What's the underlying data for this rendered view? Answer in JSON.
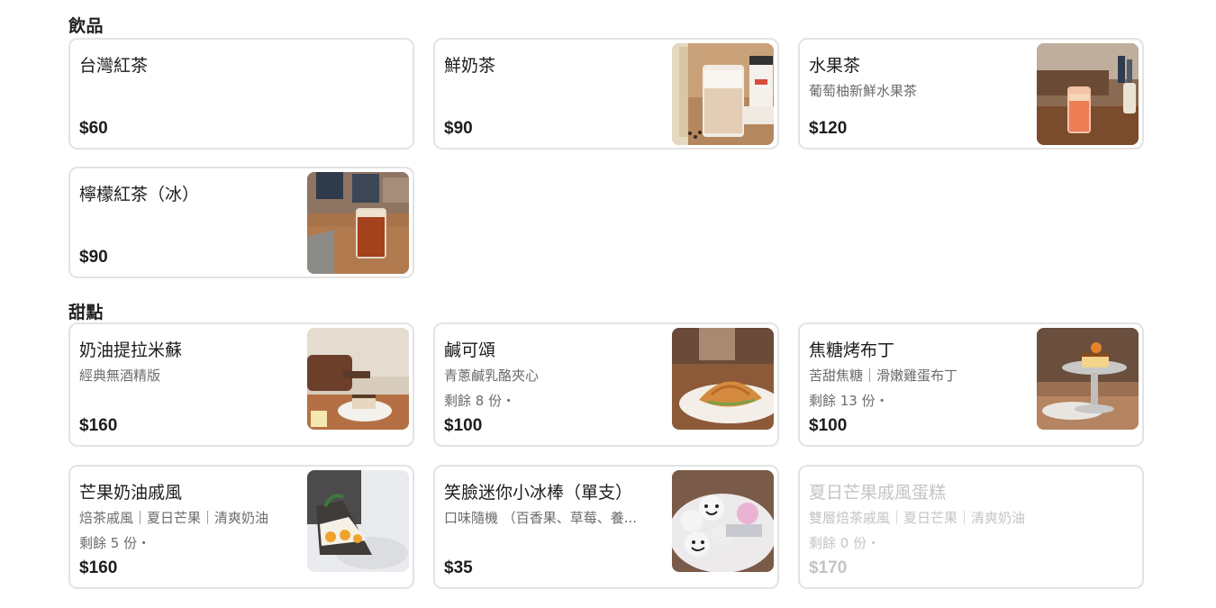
{
  "sections": [
    {
      "title": "飲品",
      "items": [
        {
          "name": "台灣紅茶",
          "desc": "",
          "stock": "",
          "price": "$60"
        },
        {
          "name": "鮮奶茶",
          "desc": "",
          "stock": "",
          "price": "$90",
          "image": "milk-tea-photo"
        },
        {
          "name": "水果茶",
          "desc": "葡萄柚新鮮水果茶",
          "stock": "",
          "price": "$120",
          "image": "fruit-tea-photo"
        },
        {
          "name": "檸檬紅茶（冰）",
          "desc": "",
          "stock": "",
          "price": "$90",
          "image": "lemon-tea-photo"
        }
      ]
    },
    {
      "title": "甜點",
      "items": [
        {
          "name": "奶油提拉米蘇",
          "desc": "經典無酒精版",
          "stock": "",
          "price": "$160",
          "image": "tiramisu-photo"
        },
        {
          "name": "鹹可頌",
          "desc": "青蔥鹹乳酪夾心",
          "stock": "剩餘 8 份・",
          "price": "$100",
          "image": "croissant-photo"
        },
        {
          "name": "焦糖烤布丁",
          "desc": "苦甜焦糖｜滑嫩雞蛋布丁",
          "stock": "剩餘 13 份・",
          "price": "$100",
          "image": "pudding-photo"
        },
        {
          "name": "芒果奶油戚風",
          "desc": "焙茶戚風｜夏日芒果｜清爽奶油",
          "stock": "剩餘 5 份・",
          "price": "$160",
          "image": "mango-chiffon-photo"
        },
        {
          "name": "笑臉迷你小冰棒（單支）",
          "desc": "口味隨機 （百香果、草莓、養...",
          "stock": "",
          "price": "$35",
          "image": "popsicle-photo"
        },
        {
          "name": "夏日芒果戚風蛋糕",
          "desc": "雙層焙茶戚風｜夏日芒果｜清爽奶油",
          "stock": "剩餘 0 份・",
          "price": "$170",
          "sold_out": true
        }
      ]
    }
  ],
  "colors": {
    "card_border": "#e3e3e3",
    "text_primary": "#1d1d1d",
    "text_secondary": "#6b6b6b",
    "disabled_text": "#c4c4c4"
  }
}
